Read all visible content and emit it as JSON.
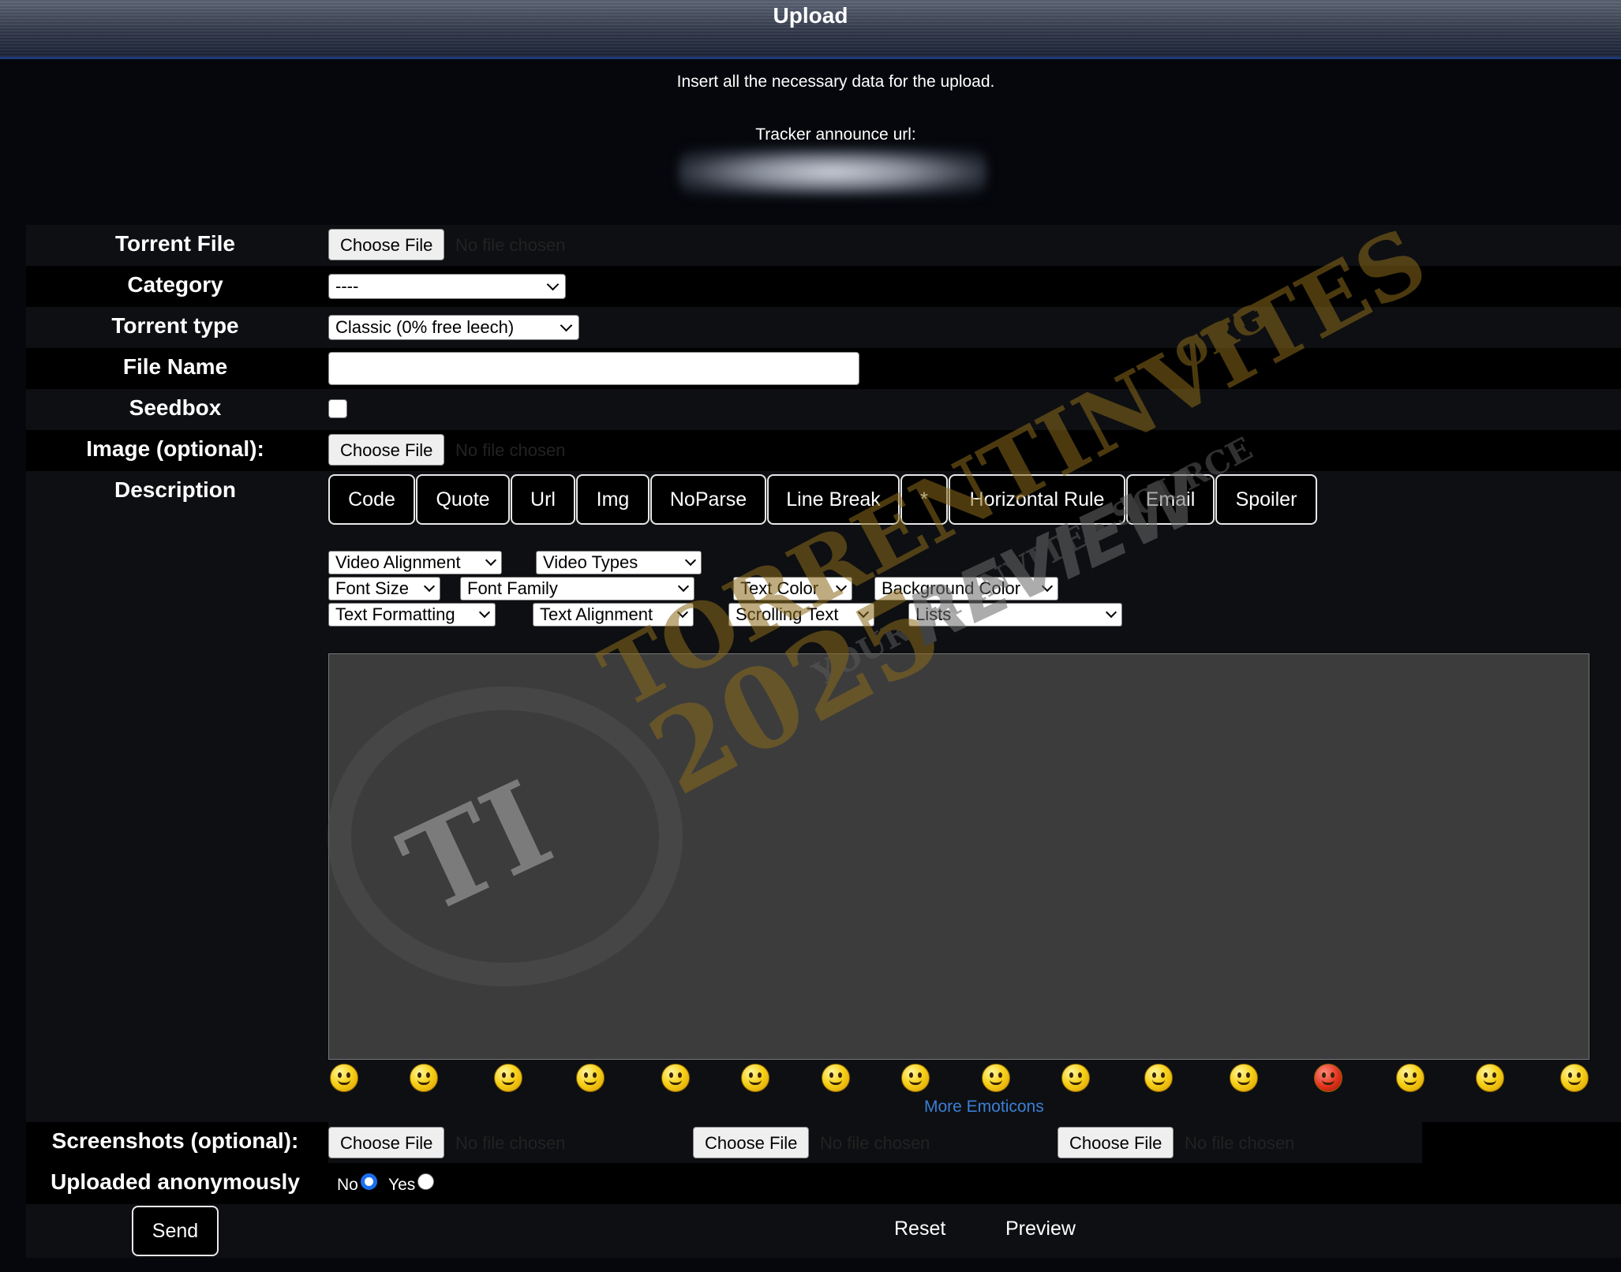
{
  "header": {
    "title": "Upload"
  },
  "intro": "Insert all the necessary data for the upload.",
  "announce_label": "Tracker announce url:",
  "form": {
    "torrent_file": {
      "label": "Torrent File",
      "button": "Choose File",
      "status": "No file chosen"
    },
    "category": {
      "label": "Category",
      "selected": "----"
    },
    "torrent_type": {
      "label": "Torrent type",
      "selected": "Classic (0% free leech)"
    },
    "file_name": {
      "label": "File Name",
      "value": ""
    },
    "seedbox": {
      "label": "Seedbox",
      "checked": false
    },
    "image": {
      "label": "Image (optional):",
      "button": "Choose File",
      "status": "No file chosen"
    },
    "description": {
      "label": "Description",
      "tag_buttons": [
        "Code",
        "Quote",
        "Url",
        "Img",
        "NoParse",
        "Line Break",
        "*",
        "Horizontal Rule",
        "Email",
        "Spoiler"
      ],
      "dropdowns": {
        "video_alignment": "Video Alignment",
        "video_types": "Video Types",
        "font_size": "Font Size",
        "font_family": "Font Family",
        "text_color": "Text Color",
        "background_color": "Background Color",
        "text_formatting": "Text Formatting",
        "text_alignment": "Text Alignment",
        "scrolling_text": "Scrolling Text",
        "lists": "Lists"
      },
      "text": "",
      "more_emoticons": "More Emoticons"
    },
    "screenshots": {
      "label": "Screenshots (optional):",
      "button": "Choose File",
      "status": "No file chosen"
    },
    "anonymous": {
      "label": "Uploaded anonymously",
      "no": "No",
      "yes": "Yes",
      "selected": "No"
    },
    "actions": {
      "send": "Send",
      "reset": "Reset",
      "preview": "Preview"
    }
  },
  "watermark": {
    "site": "TORRENTINVITES",
    "tld": "ORG",
    "tagline": "YOUR #1 INVITES SOURCE",
    "year": "2025",
    "word": "REVIEW",
    "monogram": "TI"
  },
  "colors": {
    "accent": "#1a6ff0",
    "link": "#3a7fd5",
    "row_alt": "#0e0f12"
  }
}
